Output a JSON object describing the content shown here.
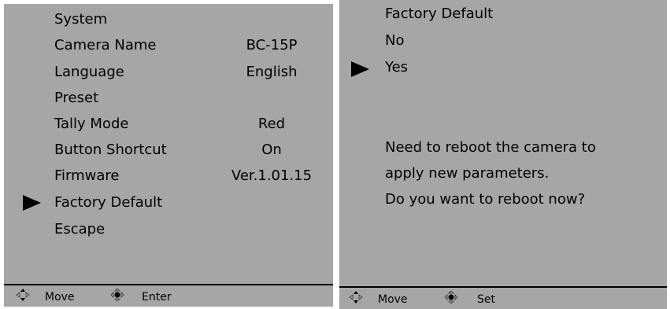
{
  "left_menu": {
    "items": [
      {
        "label": "System",
        "value": ""
      },
      {
        "label": "Camera Name",
        "value": "BC-15P"
      },
      {
        "label": "Language",
        "value": "English"
      },
      {
        "label": "Preset",
        "value": ""
      },
      {
        "label": "Tally Mode",
        "value": "Red"
      },
      {
        "label": "Button Shortcut",
        "value": "On"
      },
      {
        "label": "Firmware",
        "value": "Ver.1.01.15"
      },
      {
        "label": "Factory Default",
        "value": ""
      },
      {
        "label": "Escape",
        "value": ""
      }
    ],
    "selected_index": 7,
    "footer": {
      "move_icon": "move-arrows-icon",
      "move_label": "Move",
      "enter_icon": "enter-joystick-icon",
      "enter_label": "Enter"
    }
  },
  "right_menu": {
    "title": "Factory Default",
    "options": [
      "No",
      "Yes"
    ],
    "selected_index": 1,
    "message": [
      "Need to reboot the camera to",
      "apply new parameters.",
      "Do you want to reboot now?"
    ],
    "footer": {
      "move_icon": "move-arrows-icon",
      "move_label": "Move",
      "set_icon": "set-joystick-icon",
      "set_label": "Set"
    }
  },
  "colors": {
    "panel_background": "#a6a6a6",
    "text": "#000000"
  }
}
